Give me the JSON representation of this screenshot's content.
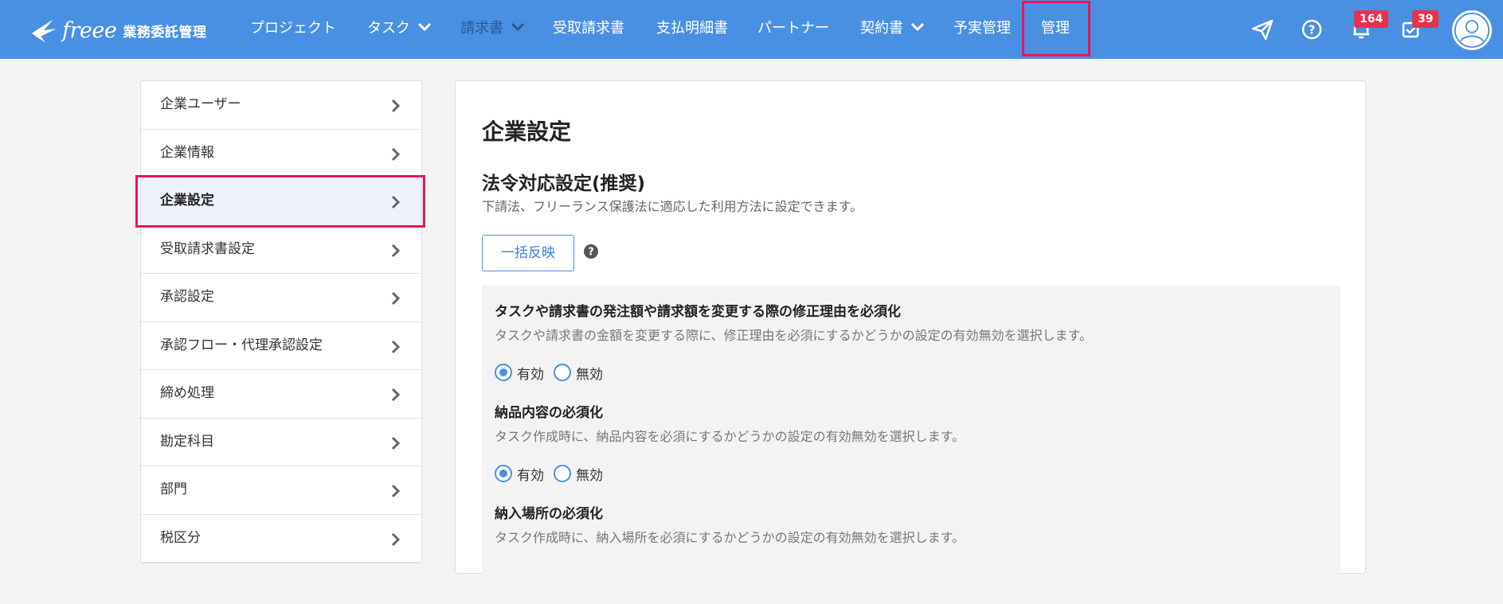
{
  "header": {
    "brand": {
      "logo": "freee",
      "product": "業務委託管理"
    },
    "nav": [
      {
        "label": "プロジェクト",
        "dropdown": false
      },
      {
        "label": "タスク",
        "dropdown": true
      },
      {
        "label": "請求書",
        "dropdown": true
      },
      {
        "label": "受取請求書",
        "dropdown": false
      },
      {
        "label": "支払明細書",
        "dropdown": false
      },
      {
        "label": "パートナー",
        "dropdown": false
      },
      {
        "label": "契約書",
        "dropdown": true
      },
      {
        "label": "予実管理",
        "dropdown": false
      },
      {
        "label": "管理",
        "dropdown": false,
        "highlighted": true
      }
    ],
    "icons": [
      "send-icon",
      "help-icon",
      "bell-icon",
      "task-check-icon",
      "avatar-icon"
    ],
    "notifications_badge": "164",
    "tasks_badge": "39"
  },
  "sidebar": {
    "items": [
      {
        "label": "企業ユーザー"
      },
      {
        "label": "企業情報"
      },
      {
        "label": "企業設定",
        "active": true
      },
      {
        "label": "受取請求書設定"
      },
      {
        "label": "承認設定"
      },
      {
        "label": "承認フロー・代理承認設定"
      },
      {
        "label": "締め処理"
      },
      {
        "label": "勘定科目"
      },
      {
        "label": "部門"
      },
      {
        "label": "税区分"
      }
    ]
  },
  "main": {
    "title": "企業設定",
    "section": {
      "title": "法令対応設定(推奨)",
      "description": "下請法、フリーランス保護法に適応した利用方法に設定できます。",
      "bulk_button": "一括反映"
    },
    "settings": [
      {
        "title": "タスクや請求書の発注額や請求額を変更する際の修正理由を必須化",
        "description": "タスクや請求書の金額を変更する際に、修正理由を必須にするかどうかの設定の有効無効を選択します。",
        "options": [
          "有効",
          "無効"
        ],
        "selected": "有効"
      },
      {
        "title": "納品内容の必須化",
        "description": "タスク作成時に、納品内容を必須にするかどうかの設定の有効無効を選択します。",
        "options": [
          "有効",
          "無効"
        ],
        "selected": "有効"
      },
      {
        "title": "納入場所の必須化",
        "description": "タスク作成時に、納入場所を必須にするかどうかの設定の有効無効を選択します。"
      }
    ]
  },
  "colors": {
    "header_bg": "#4a90e2",
    "accent": "#4a90e2",
    "highlight_frame": "#e8145f",
    "badge": "#e8324a"
  }
}
